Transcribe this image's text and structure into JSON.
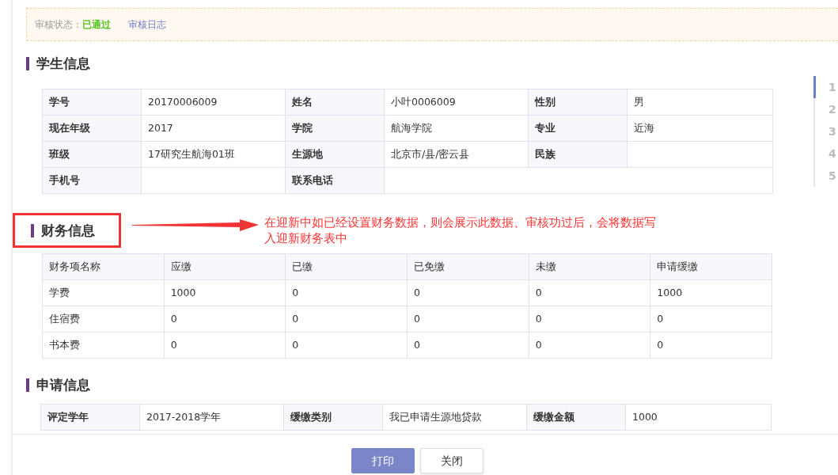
{
  "audit": {
    "label": "审核状态：",
    "value": "已通过",
    "log_link": "审核日志"
  },
  "nav_steps": [
    {
      "label": "1",
      "selected": true
    },
    {
      "label": "2",
      "selected": false
    },
    {
      "label": "3",
      "selected": false
    },
    {
      "label": "4",
      "selected": false
    },
    {
      "label": "5",
      "selected": false
    }
  ],
  "student_info": {
    "title": "学生信息",
    "rows": [
      [
        {
          "label": "学号",
          "value": "20170006009"
        },
        {
          "label": "姓名",
          "value": "小叶0006009"
        },
        {
          "label": "性别",
          "value": "男"
        }
      ],
      [
        {
          "label": "现在年级",
          "value": "2017"
        },
        {
          "label": "学院",
          "value": "航海学院"
        },
        {
          "label": "专业",
          "value": "近海"
        }
      ],
      [
        {
          "label": "班级",
          "value": "17研究生航海01班"
        },
        {
          "label": "生源地",
          "value": "北京市/县/密云县"
        },
        {
          "label": "民族"
        }
      ],
      [
        {
          "label": "手机号"
        },
        {
          "label": "联系电话"
        }
      ]
    ]
  },
  "finance_info": {
    "title": "财务信息",
    "annotation": "在迎新中如已经设置财务数据，则会展示此数据、审核功过后，会将数据写入迎新财务表中",
    "columns": [
      "财务项名称",
      "应缴",
      "已缴",
      "已免缴",
      "未缴",
      "申请缓缴"
    ],
    "rows": [
      [
        "学费",
        "1000",
        "0",
        "0",
        "0",
        "1000"
      ],
      [
        "住宿费",
        "0",
        "0",
        "0",
        "0",
        "0"
      ],
      [
        "书本费",
        "0",
        "0",
        "0",
        "0",
        "0"
      ]
    ]
  },
  "application_info": {
    "title": "申请信息",
    "rows": [
      [
        {
          "label": "评定学年",
          "value": "2017-2018学年"
        },
        {
          "label": "缓缴类别",
          "value": "我已申请生源地贷款"
        },
        {
          "label": "缓缴金额",
          "value": "1000"
        }
      ]
    ]
  },
  "buttons": [
    {
      "label": "打印",
      "kind": "primary"
    },
    {
      "label": "关闭",
      "kind": "default"
    }
  ]
}
